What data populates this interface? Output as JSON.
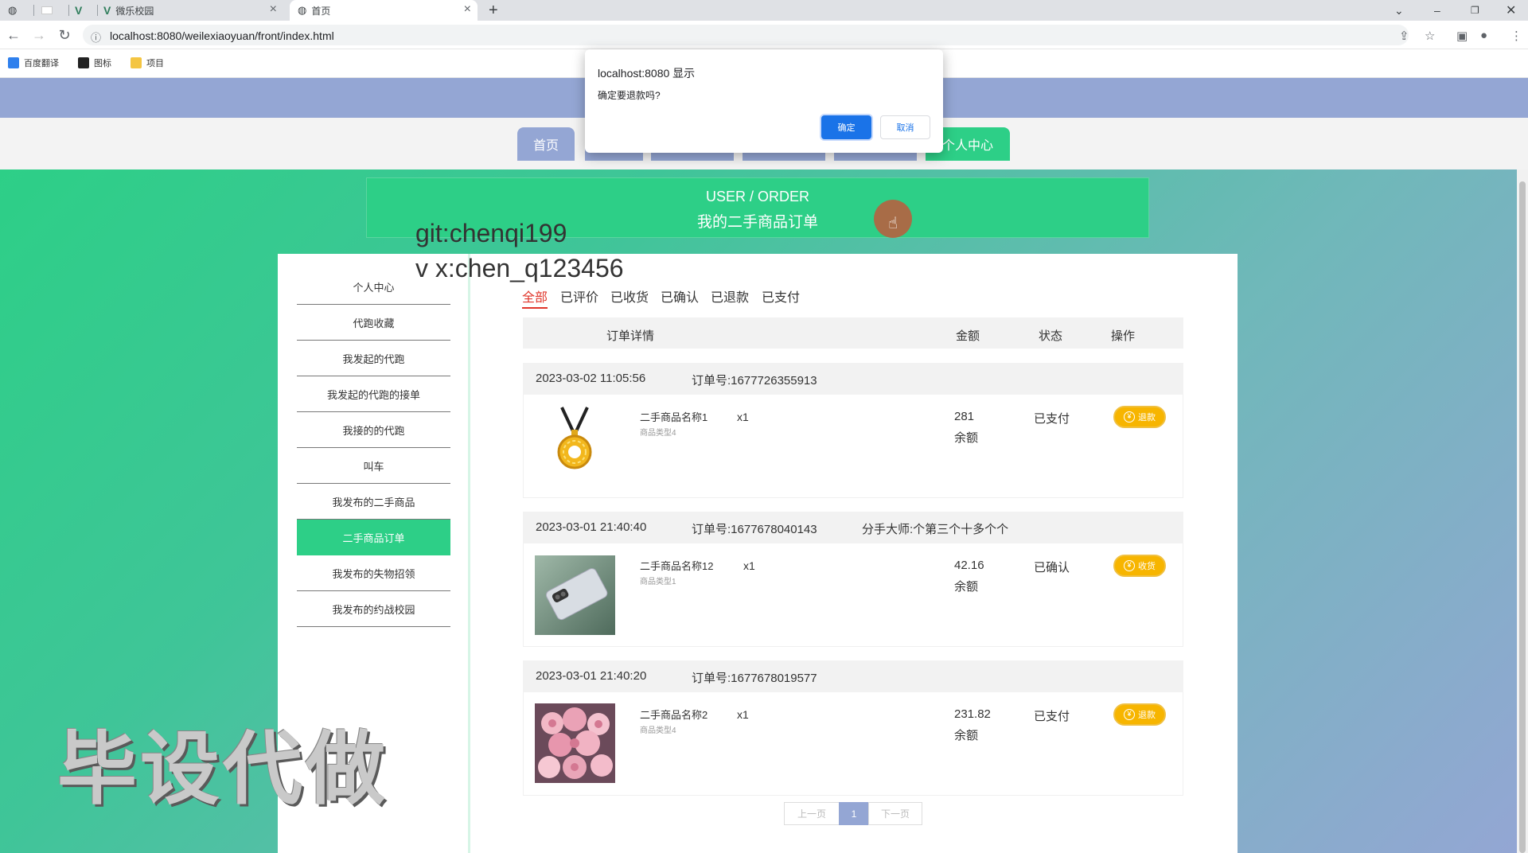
{
  "browser": {
    "tabs": [
      {
        "label": ""
      },
      {
        "label": ""
      },
      {
        "label": ""
      },
      {
        "label": "微乐校园"
      },
      {
        "label": "首页"
      }
    ],
    "url": "localhost:8080/weilexiaoyuan/front/index.html",
    "bookmarks": [
      {
        "label": "百度翻译",
        "color": "#2f80ed"
      },
      {
        "label": "图标",
        "color": "#222222"
      },
      {
        "label": "项目",
        "color": "#f4c542"
      }
    ]
  },
  "dialog": {
    "title": "localhost:8080 显示",
    "message": "确定要退款吗?",
    "ok_label": "确定",
    "cancel_label": "取消"
  },
  "nav": {
    "items": [
      {
        "label": "首页",
        "color": "#94a6d4"
      },
      {
        "label": "",
        "color": "#94a6d4"
      },
      {
        "label": "",
        "color": "#94a6d4"
      },
      {
        "label": "",
        "color": "#94a6d4"
      },
      {
        "label": "",
        "color": "#94a6d4"
      },
      {
        "label": "个人中心",
        "color": "#2dcf87"
      }
    ]
  },
  "header": {
    "title_en": "USER / ORDER",
    "title_cn": "我的二手商品订单"
  },
  "sidebar": {
    "items": [
      {
        "label": "个人中心"
      },
      {
        "label": "代跑收藏"
      },
      {
        "label": "我发起的代跑"
      },
      {
        "label": "我发起的代跑的接单"
      },
      {
        "label": "我接的的代跑"
      },
      {
        "label": "叫车"
      },
      {
        "label": "我发布的二手商品"
      },
      {
        "label": "二手商品订单",
        "active": true
      },
      {
        "label": "我发布的失物招领"
      },
      {
        "label": "我发布的约战校园"
      }
    ]
  },
  "filter_tabs": [
    "全部",
    "已评价",
    "已收货",
    "已确认",
    "已退款",
    "已支付"
  ],
  "table": {
    "headers": [
      "订单详情",
      "金额",
      "状态",
      "操作"
    ]
  },
  "orders": [
    {
      "datetime": "2023-03-02 11:05:56",
      "order_no": "订单号:1677726355913",
      "extra": "",
      "product_name": "二手商品名称1",
      "product_type": "商品类型4",
      "qty": "x1",
      "amount": "281",
      "pay_method": "余额",
      "status": "已支付",
      "action": "退款",
      "thumb": "pendant"
    },
    {
      "datetime": "2023-03-01 21:40:40",
      "order_no": "订单号:1677678040143",
      "extra": "分手大师:个第三个十多个个",
      "product_name": "二手商品名称12",
      "product_type": "商品类型1",
      "qty": "x1",
      "amount": "42.16",
      "pay_method": "余额",
      "status": "已确认",
      "action": "收货",
      "thumb": "phone"
    },
    {
      "datetime": "2023-03-01 21:40:20",
      "order_no": "订单号:1677678019577",
      "extra": "",
      "product_name": "二手商品名称2",
      "product_type": "商品类型4",
      "qty": "x1",
      "amount": "231.82",
      "pay_method": "余额",
      "status": "已支付",
      "action": "退款",
      "thumb": "roses"
    }
  ],
  "pagination": {
    "prev": "上一页",
    "current": "1",
    "next": "下一页"
  },
  "watermarks": {
    "line1": "git:chenqi199",
    "line2": "v x:chen_q123456",
    "big": "毕设代做"
  }
}
